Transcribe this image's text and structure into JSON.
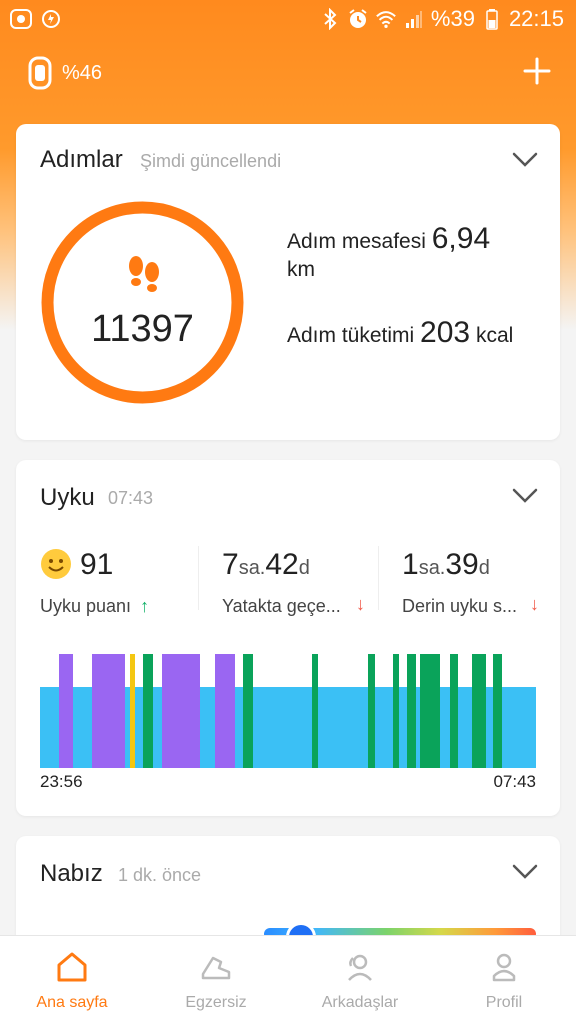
{
  "status_bar": {
    "battery_percent": "%39",
    "time": "22:15"
  },
  "header": {
    "band_battery": "%46"
  },
  "steps_card": {
    "title": "Adımlar",
    "subtitle": "Şimdi güncellendi",
    "count": "11397",
    "distance_label": "Adım mesafesi",
    "distance_value": "6,94",
    "distance_unit": "km",
    "calories_label": "Adım tüketimi",
    "calories_value": "203",
    "calories_unit": "kcal",
    "ring_color": "#ff7a12"
  },
  "sleep_card": {
    "title": "Uyku",
    "subtitle": "07:43",
    "score": "91",
    "score_label": "Uyku puanı",
    "bed_hours": "7",
    "bed_hours_unit": "sa.",
    "bed_minutes": "42",
    "bed_minutes_unit": "d",
    "bed_label": "Yatakta geçe...",
    "deep_hours": "1",
    "deep_hours_unit": "sa.",
    "deep_minutes": "39",
    "deep_minutes_unit": "d",
    "deep_label": "Derin uyku s...",
    "start_time": "23:56",
    "end_time": "07:43",
    "colors": {
      "light": "#3bc0f5",
      "awake": "#9a66f2",
      "rem": "#f4c712",
      "deep": "#0aa35a",
      "up_arrow": "#16b26b",
      "down_arrow": "#f05a4a"
    }
  },
  "heart_card": {
    "title": "Nabız",
    "subtitle": "1 dk. önce"
  },
  "bottom_nav": {
    "items": [
      {
        "label": "Ana sayfa",
        "icon": "home-icon",
        "active": true
      },
      {
        "label": "Egzersiz",
        "icon": "shoe-icon",
        "active": false
      },
      {
        "label": "Arkadaşlar",
        "icon": "friends-icon",
        "active": false
      },
      {
        "label": "Profil",
        "icon": "profile-icon",
        "active": false
      }
    ]
  }
}
